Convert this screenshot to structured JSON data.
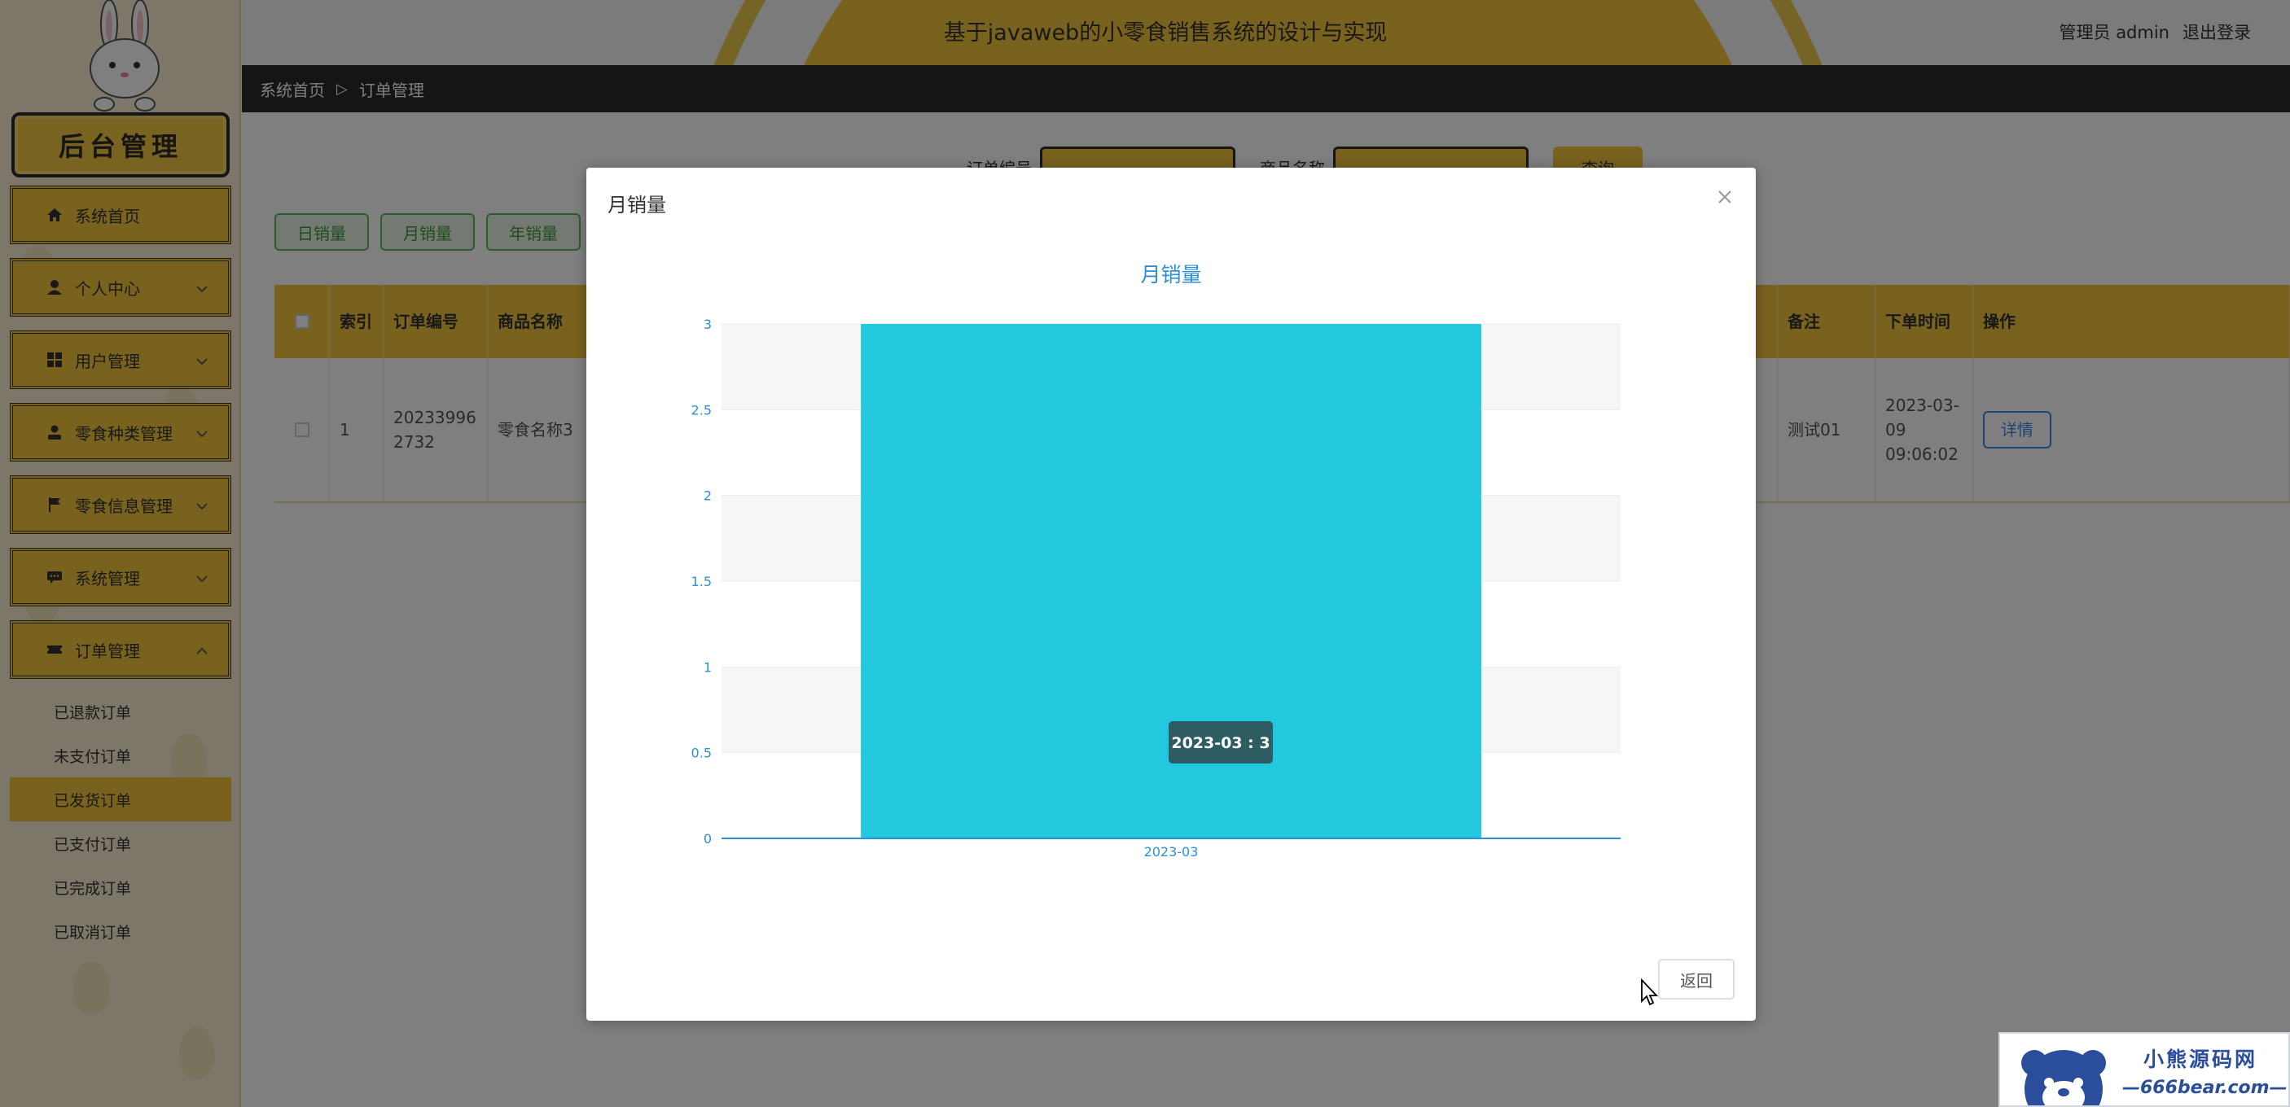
{
  "sidebar": {
    "logo_text": "后台管理",
    "menu": [
      {
        "label": "系统首页",
        "icon": "home-icon",
        "has_chevron": false
      },
      {
        "label": "个人中心",
        "icon": "user-icon",
        "has_chevron": true
      },
      {
        "label": "用户管理",
        "icon": "grid-icon",
        "has_chevron": true
      },
      {
        "label": "零食种类管理",
        "icon": "person-icon",
        "has_chevron": true
      },
      {
        "label": "零食信息管理",
        "icon": "flag-icon",
        "has_chevron": true
      },
      {
        "label": "系统管理",
        "icon": "chat-icon",
        "has_chevron": true
      },
      {
        "label": "订单管理",
        "icon": "ticket-icon",
        "has_chevron": true,
        "expanded": true
      }
    ],
    "sub_items": [
      {
        "label": "已退款订单",
        "active": false
      },
      {
        "label": "未支付订单",
        "active": false
      },
      {
        "label": "已发货订单",
        "active": true
      },
      {
        "label": "已支付订单",
        "active": false
      },
      {
        "label": "已完成订单",
        "active": false
      },
      {
        "label": "已取消订单",
        "active": false
      }
    ]
  },
  "header": {
    "title": "基于javaweb的小零食销售系统的设计与实现",
    "user": "管理员 admin",
    "logout": "退出登录"
  },
  "breadcrumb": {
    "home": "系统首页",
    "separator": "▷",
    "current": "订单管理"
  },
  "search": {
    "order_label": "订单编号",
    "product_label": "商品名称",
    "button": "查询"
  },
  "stat_buttons": [
    "日销量",
    "月销量",
    "年销量"
  ],
  "table": {
    "headers": [
      "索引",
      "订单编号",
      "商品名称",
      "备注",
      "下单时间",
      "操作"
    ],
    "row": {
      "index": "1",
      "order_no": "202339962732",
      "product": "零食名称3",
      "remark": "测试01",
      "time": "2023-03-09 09:06:02",
      "action": "详情"
    }
  },
  "modal": {
    "title": "月销量",
    "return_button": "返回",
    "tooltip": "2023-03 : 3"
  },
  "chart_data": {
    "type": "bar",
    "title": "月销量",
    "categories": [
      "2023-03"
    ],
    "values": [
      3
    ],
    "ylim": [
      0,
      3
    ],
    "yticks": [
      "0",
      "0.5",
      "1",
      "1.5",
      "2",
      "2.5",
      "3"
    ],
    "grid": "horizontal bands",
    "bar_color": "#22c8de",
    "axis_color": "#2e8fd6"
  },
  "watermark": {
    "line1": "小熊源码网",
    "line2": "—666bear.com—"
  },
  "colors": {
    "accent": "#f2c33d",
    "dark": "#2a2a2a",
    "sidebar_bg": "#f8eed0",
    "overlay": "rgba(0,0,0,0.5)"
  }
}
